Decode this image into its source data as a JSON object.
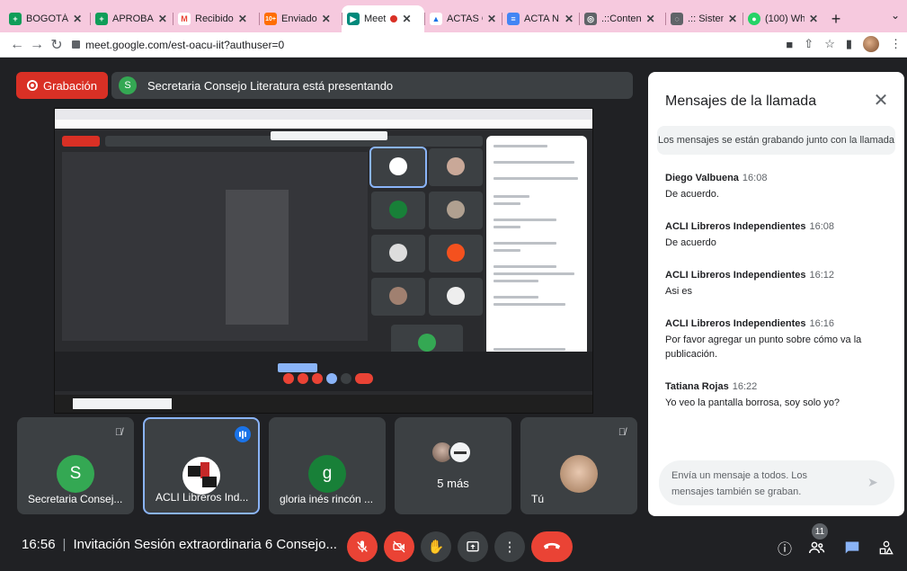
{
  "browser": {
    "tabs": [
      {
        "title": "BOGOTÁ",
        "fav_color": "#0f9d58",
        "fav_glyph": "+"
      },
      {
        "title": "APROBA",
        "fav_color": "#0f9d58",
        "fav_glyph": "+"
      },
      {
        "title": "Recibido",
        "fav_color": "#ea4335",
        "fav_glyph": "M"
      },
      {
        "title": "Enviado",
        "fav_color": "#ff6d00",
        "fav_glyph": "10+"
      },
      {
        "title": "Meet",
        "fav_color": "#00897b",
        "fav_glyph": "▶",
        "active": true
      },
      {
        "title": "ACTAS C",
        "fav_color": "#1a73e8",
        "fav_glyph": "▲"
      },
      {
        "title": "ACTA N.",
        "fav_color": "#4285f4",
        "fav_glyph": "≡"
      },
      {
        "title": ".::Conten",
        "fav_color": "#5f6368",
        "fav_glyph": "◎"
      },
      {
        "title": ".:: Sistem",
        "fav_color": "#5f6368",
        "fav_glyph": "◌"
      },
      {
        "title": "(100) Wh",
        "fav_color": "#25d366",
        "fav_glyph": "●"
      }
    ],
    "new_tab_label": "+",
    "url": "meet.google.com/est-oacu-iit?authuser=0"
  },
  "meet": {
    "recording_label": "Grabación",
    "presenter_initial": "S",
    "presenting_text": "Secretaria Consejo Literatura está presentando",
    "participants": [
      {
        "name": "Secretaria Consej...",
        "initial": "S",
        "color": "#34a853",
        "muted": true
      },
      {
        "name": "ACLI Libreros Ind...",
        "initial": "",
        "color": "#ffffff",
        "speaking": true
      },
      {
        "name": "gloria inés rincón ...",
        "initial": "g",
        "color": "#188038",
        "muted": false
      },
      {
        "name": "",
        "more_label": "5 más"
      },
      {
        "name": "Tú",
        "muted": true
      }
    ],
    "time": "16:56",
    "meeting_title": "Invitación Sesión extraordinaria 6 Consejo...",
    "people_count": "11",
    "accent": "#8ab4f8",
    "danger": "#ea4335"
  },
  "chat": {
    "title": "Mensajes de la llamada",
    "banner": "Los mensajes se están grabando junto con la llamada",
    "messages": [
      {
        "sender": "Diego Valbuena",
        "time": "16:08",
        "text": "De acuerdo."
      },
      {
        "sender": "ACLI Libreros Independientes",
        "time": "16:08",
        "text": "De acuerdo"
      },
      {
        "sender": "ACLI Libreros Independientes",
        "time": "16:12",
        "text": "Asi es"
      },
      {
        "sender": "ACLI Libreros Independientes",
        "time": "16:16",
        "text": "Por favor agregar un punto sobre cómo va la publicación."
      },
      {
        "sender": "Tatiana Rojas",
        "time": "16:22",
        "text": "Yo veo la pantalla borrosa, soy solo yo?"
      }
    ],
    "input_placeholder": "Envía un mensaje a todos. Los mensajes también se graban."
  }
}
